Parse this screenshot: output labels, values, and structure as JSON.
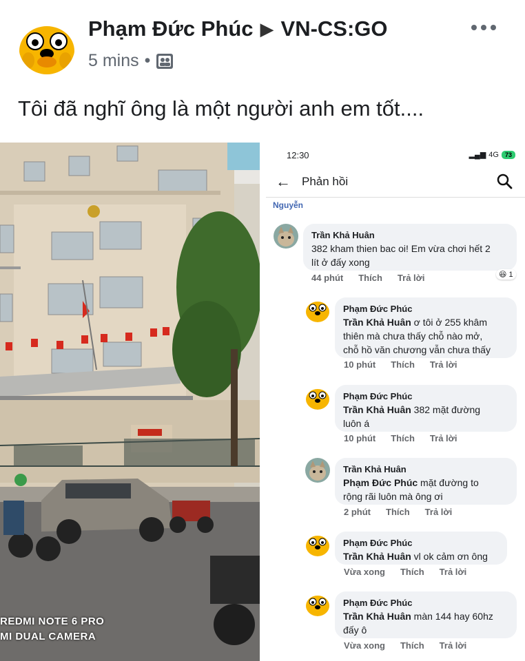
{
  "post": {
    "author": "Phạm Đức Phúc",
    "arrow": "▶",
    "group": "VN-CS:GO",
    "time": "5 mins",
    "separator": "•",
    "text": "Tôi đã nghĩ ông là một người anh em tốt....",
    "more_icon": "more-dots-icon"
  },
  "photo": {
    "caption_line1": "REDMI NOTE 6 PRO",
    "caption_line2": "MI DUAL CAMERA"
  },
  "phone": {
    "status_time": "12:30",
    "status_network": "4G",
    "battery": "73",
    "title": "Phản hồi",
    "cut_name": "Nguyễn",
    "comments": [
      {
        "author": "Trần Khả Huân",
        "mention": "",
        "text_line1": "382 kham thien bac oi! Em vừa chơi hết 2",
        "text_line2": "lít ở đấy xong",
        "text_line3": "",
        "time": "44 phút",
        "like": "Thích",
        "reply": "Trả lời",
        "reaction_count": "1"
      },
      {
        "author": "Phạm Đức Phúc",
        "mention": "Trần Khả Huân",
        "text_line1": " ơ tôi ở 255 khâm",
        "text_line2": "thiên mà chưa thấy chỗ nào mở,",
        "text_line3": "chỗ hồ văn chương vẫn chưa thấy",
        "time": "10 phút",
        "like": "Thích",
        "reply": "Trả lời"
      },
      {
        "author": "Phạm Đức Phúc",
        "mention": "Trần Khả Huân",
        "text_line1": " 382 mặt đường",
        "text_line2": "luôn á",
        "text_line3": "",
        "time": "10 phút",
        "like": "Thích",
        "reply": "Trả lời"
      },
      {
        "author": "Trần Khả Huân",
        "mention": "Phạm Đức Phúc",
        "text_line1": "  mặt đường to",
        "text_line2": "rộng rãi luôn mà ông ơi",
        "text_line3": "",
        "time": "2 phút",
        "like": "Thích",
        "reply": "Trả lời"
      },
      {
        "author": "Phạm Đức Phúc",
        "mention": "Trần Khả Huân",
        "text_line1": " vl ok cảm ơn ông",
        "text_line2": "",
        "text_line3": "",
        "time": "Vừa xong",
        "like": "Thích",
        "reply": "Trả lời"
      },
      {
        "author": "Phạm Đức Phúc",
        "mention": "Trần Khả Huân",
        "text_line1": " màn 144 hay 60hz",
        "text_line2": "đấy ô",
        "text_line3": "",
        "time": "Vừa xong",
        "like": "Thích",
        "reply": "Trả lời"
      }
    ]
  },
  "colors": {
    "bubble": "#f0f2f5",
    "link": "#4267b2",
    "jake": "#f7b500"
  }
}
